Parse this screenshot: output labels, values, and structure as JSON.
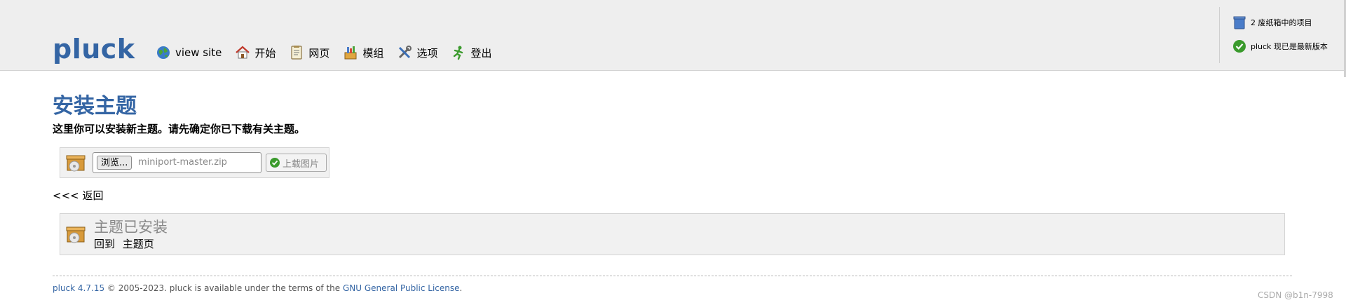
{
  "header": {
    "logo": "pluck",
    "menu": [
      {
        "label": "view site",
        "icon": "globe-icon"
      },
      {
        "label": "开始",
        "icon": "home-icon"
      },
      {
        "label": "网页",
        "icon": "page-icon"
      },
      {
        "label": "模组",
        "icon": "modules-icon"
      },
      {
        "label": "选项",
        "icon": "tools-icon"
      },
      {
        "label": "登出",
        "icon": "logout-icon"
      }
    ],
    "status": {
      "trash": "2 废纸箱中的项目",
      "version": "pluck 现已是最新版本"
    }
  },
  "main": {
    "title": "安装主题",
    "description": "这里你可以安装新主题。请先确定你已下载有关主题。",
    "upload": {
      "browse_label": "浏览...",
      "file_name": "miniport-master.zip",
      "submit_label": "上载图片"
    },
    "back_link": "<<< 返回",
    "success": {
      "title": "主题已安装",
      "back_to": "回到",
      "theme_page": "主题页"
    }
  },
  "footer": {
    "version": "pluck 4.7.15",
    "copyright": " © 2005-2023. pluck is available under the terms of the ",
    "license": "GNU General Public License",
    "period": "."
  },
  "watermark": "CSDN @b1n-7998",
  "colors": {
    "brand": "#3465a4",
    "header_bg": "#eeeeee",
    "box_bg": "#f1f1f1",
    "success_green": "#3a9a2c"
  }
}
